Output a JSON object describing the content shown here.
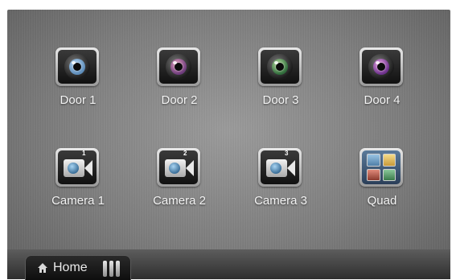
{
  "tiles": [
    {
      "label": "Door 1",
      "icon": "door-camera-icon",
      "lens_color": "#7fa9d6"
    },
    {
      "label": "Door 2",
      "icon": "door-camera-icon",
      "lens_color": "#7a4a86"
    },
    {
      "label": "Door 3",
      "icon": "door-camera-icon",
      "lens_color": "#3f8a4b"
    },
    {
      "label": "Door 4",
      "icon": "door-camera-icon",
      "lens_color": "#7c3b91"
    },
    {
      "label": "Camera 1",
      "icon": "video-camera-icon",
      "badge": "1"
    },
    {
      "label": "Camera 2",
      "icon": "video-camera-icon",
      "badge": "2"
    },
    {
      "label": "Camera 3",
      "icon": "video-camera-icon",
      "badge": "3"
    },
    {
      "label": "Quad",
      "icon": "quad-view-icon",
      "cell_colors": [
        "#6aa0c8",
        "#e4c76a",
        "#c86a5a",
        "#5f9a6a"
      ]
    }
  ],
  "bottom_bar": {
    "home_label": "Home",
    "home_icon": "home-icon",
    "grip_icon": "grip-icon"
  }
}
